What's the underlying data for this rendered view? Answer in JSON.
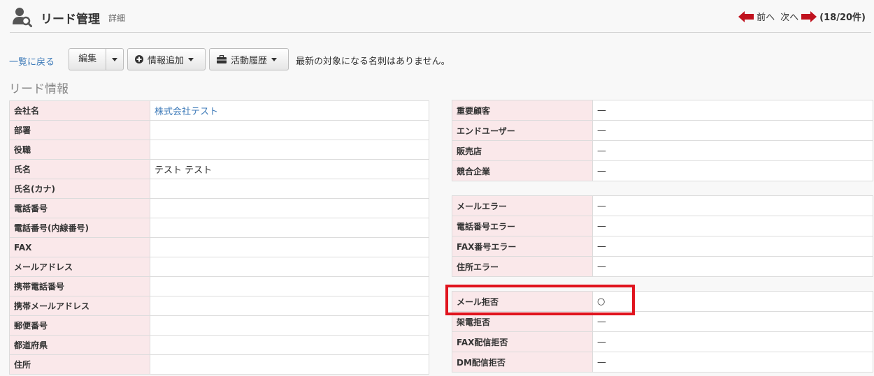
{
  "header": {
    "title": "リード管理",
    "subtitle": "詳細",
    "prev_label": "前へ",
    "next_label": "次へ",
    "count_label": "(18/20件)",
    "icon": "user-search-icon"
  },
  "toolbar": {
    "back_label": "一覧に戻る",
    "edit_label": "編集",
    "add_info_label": "情報追加",
    "history_label": "活動履歴",
    "message": "最新の対象になる名刺はありません。"
  },
  "section_title": "リード情報",
  "left_rows": [
    {
      "label": "会社名",
      "value": "株式会社テスト"
    },
    {
      "label": "部署",
      "value": ""
    },
    {
      "label": "役職",
      "value": ""
    },
    {
      "label": "氏名",
      "value": "テスト テスト"
    },
    {
      "label": "氏名(カナ)",
      "value": ""
    },
    {
      "label": "電話番号",
      "value": ""
    },
    {
      "label": "電話番号(内線番号)",
      "value": ""
    },
    {
      "label": "FAX",
      "value": ""
    },
    {
      "label": "メールアドレス",
      "value": ""
    },
    {
      "label": "携帯電話番号",
      "value": ""
    },
    {
      "label": "携帯メールアドレス",
      "value": ""
    },
    {
      "label": "郵便番号",
      "value": ""
    },
    {
      "label": "都道府県",
      "value": ""
    },
    {
      "label": "住所",
      "value": ""
    }
  ],
  "right_group1": [
    {
      "label": "重要顧客",
      "value": "—"
    },
    {
      "label": "エンドユーザー",
      "value": "—"
    },
    {
      "label": "販売店",
      "value": "—"
    },
    {
      "label": "競合企業",
      "value": "—"
    }
  ],
  "right_group2": [
    {
      "label": "メールエラー",
      "value": "—"
    },
    {
      "label": "電話番号エラー",
      "value": "—"
    },
    {
      "label": "FAX番号エラー",
      "value": "—"
    },
    {
      "label": "住所エラー",
      "value": "—"
    }
  ],
  "right_group3": [
    {
      "label": "メール拒否",
      "value": "○"
    },
    {
      "label": "架電拒否",
      "value": "—"
    },
    {
      "label": "FAX配信拒否",
      "value": "—"
    },
    {
      "label": "DM配信拒否",
      "value": "—"
    }
  ],
  "colors": {
    "label_bg": "#fae8ea",
    "link": "#3d7ab8",
    "arrow": "#c0121e",
    "highlight": "#e0141e"
  }
}
